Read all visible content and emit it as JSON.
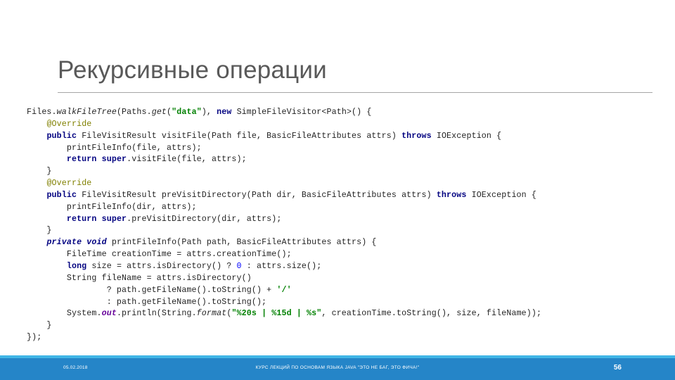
{
  "slide": {
    "title": "Рекурсивные операции",
    "accent_color": "#2585c8",
    "accent_light_color": "#41b6e6",
    "title_color": "#595959"
  },
  "code": {
    "language": "java",
    "lines": [
      [
        {
          "t": "Files.",
          "c": "pln"
        },
        {
          "t": "walkFileTree",
          "c": "mth"
        },
        {
          "t": "(Paths.",
          "c": "pln"
        },
        {
          "t": "get",
          "c": "mth"
        },
        {
          "t": "(",
          "c": "pln"
        },
        {
          "t": "\"data\"",
          "c": "str"
        },
        {
          "t": "), ",
          "c": "pln"
        },
        {
          "t": "new",
          "c": "kw"
        },
        {
          "t": " SimpleFileVisitor<Path>() {",
          "c": "pln"
        }
      ],
      [
        {
          "t": "    ",
          "c": "pln"
        },
        {
          "t": "@Override",
          "c": "ann"
        }
      ],
      [
        {
          "t": "    ",
          "c": "pln"
        },
        {
          "t": "public",
          "c": "kw"
        },
        {
          "t": " FileVisitResult visitFile(Path file, BasicFileAttributes attrs) ",
          "c": "pln"
        },
        {
          "t": "throws",
          "c": "kw"
        },
        {
          "t": " IOException {",
          "c": "pln"
        }
      ],
      [
        {
          "t": "        printFileInfo(file, attrs);",
          "c": "pln"
        }
      ],
      [
        {
          "t": "        ",
          "c": "pln"
        },
        {
          "t": "return",
          "c": "kw"
        },
        {
          "t": " ",
          "c": "pln"
        },
        {
          "t": "super",
          "c": "kw"
        },
        {
          "t": ".visitFile(file, attrs);",
          "c": "pln"
        }
      ],
      [
        {
          "t": "    }",
          "c": "pln"
        }
      ],
      [
        {
          "t": "    ",
          "c": "pln"
        },
        {
          "t": "@Override",
          "c": "ann"
        }
      ],
      [
        {
          "t": "    ",
          "c": "pln"
        },
        {
          "t": "public",
          "c": "kw"
        },
        {
          "t": " FileVisitResult preVisitDirectory(Path dir, BasicFileAttributes attrs) ",
          "c": "pln"
        },
        {
          "t": "throws",
          "c": "kw"
        },
        {
          "t": " IOException {",
          "c": "pln"
        }
      ],
      [
        {
          "t": "        printFileInfo(dir, attrs);",
          "c": "pln"
        }
      ],
      [
        {
          "t": "        ",
          "c": "pln"
        },
        {
          "t": "return",
          "c": "kw"
        },
        {
          "t": " ",
          "c": "pln"
        },
        {
          "t": "super",
          "c": "kw"
        },
        {
          "t": ".preVisitDirectory(dir, attrs);",
          "c": "pln"
        }
      ],
      [
        {
          "t": "    }",
          "c": "pln"
        }
      ],
      [
        {
          "t": "    ",
          "c": "pln"
        },
        {
          "t": "private void",
          "c": "kwi"
        },
        {
          "t": " printFileInfo(Path path, BasicFileAttributes attrs) {",
          "c": "pln"
        }
      ],
      [
        {
          "t": "        FileTime creationTime = attrs.creationTime();",
          "c": "pln"
        }
      ],
      [
        {
          "t": "        ",
          "c": "pln"
        },
        {
          "t": "long",
          "c": "kw"
        },
        {
          "t": " size = attrs.isDirectory() ? ",
          "c": "pln"
        },
        {
          "t": "0",
          "c": "num"
        },
        {
          "t": " : attrs.size();",
          "c": "pln"
        }
      ],
      [
        {
          "t": "        String fileName = attrs.isDirectory()",
          "c": "pln"
        }
      ],
      [
        {
          "t": "                ? path.getFileName().toString() + ",
          "c": "pln"
        },
        {
          "t": "'/'",
          "c": "str"
        }
      ],
      [
        {
          "t": "                : path.getFileName().toString();",
          "c": "pln"
        }
      ],
      [
        {
          "t": "        System.",
          "c": "pln"
        },
        {
          "t": "out",
          "c": "fld"
        },
        {
          "t": ".println(String.",
          "c": "pln"
        },
        {
          "t": "format",
          "c": "mth"
        },
        {
          "t": "(",
          "c": "pln"
        },
        {
          "t": "\"%20s | %15d | %s\"",
          "c": "str"
        },
        {
          "t": ", creationTime.toString(), size, fileName));",
          "c": "pln"
        }
      ],
      [
        {
          "t": "    }",
          "c": "pln"
        }
      ],
      [
        {
          "t": "});",
          "c": "pln"
        }
      ]
    ]
  },
  "footer": {
    "date": "05.02.2018",
    "course": "КУРС ЛЕКЦИЙ ПО ОСНОВАМ ЯЗЫКА JAVA \"ЭТО НЕ БАГ, ЭТО ФИЧА!\"",
    "page_number": "56"
  }
}
